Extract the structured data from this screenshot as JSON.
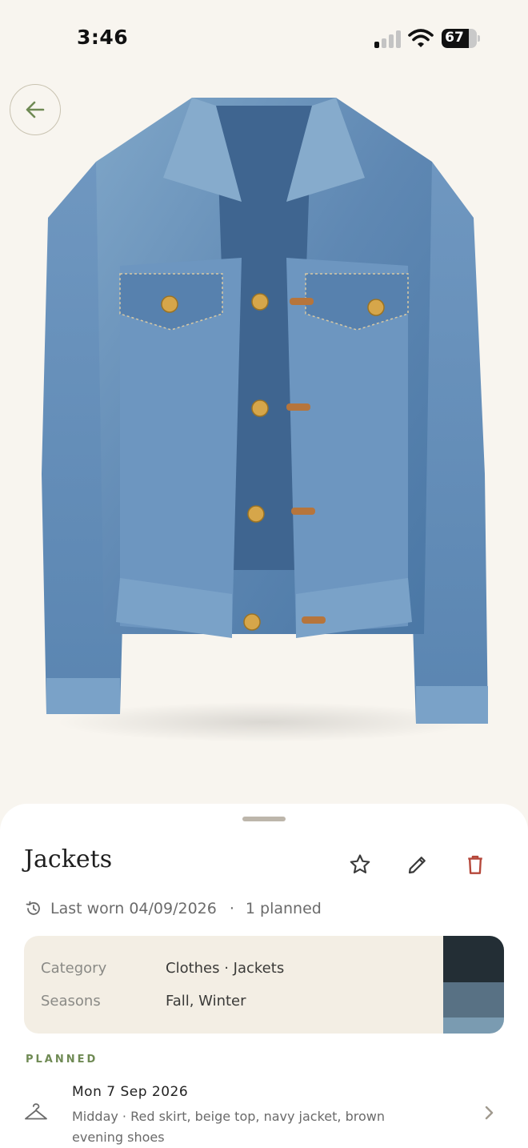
{
  "status": {
    "time": "3:46",
    "battery": "67"
  },
  "item": {
    "title": "Jackets",
    "last_worn": "Last worn 04/09/2026",
    "separator": "·",
    "planned_count": "1 planned"
  },
  "details": [
    {
      "label": "Category",
      "value": "Clothes · Jackets"
    },
    {
      "label": "Seasons",
      "value": "Fall, Winter"
    }
  ],
  "swatch_colors": [
    "#232e35",
    "#587184",
    "#7a9bb1"
  ],
  "planned": {
    "section_label": "PLANNED",
    "items": [
      {
        "date": "Mon 7 Sep 2026",
        "description": "Midday · Red skirt, beige top, navy jacket, brown evening shoes"
      }
    ]
  },
  "icons": {
    "back": "arrow-left-icon",
    "favorite": "star-icon",
    "edit": "pencil-icon",
    "delete": "trash-icon",
    "history": "history-icon",
    "hanger": "hanger-icon",
    "chevron": "chevron-right-icon"
  },
  "colors": {
    "accent": "#6f8a54",
    "delete": "#b5473a",
    "background": "#f8f5ef",
    "card": "#f3eee4"
  }
}
